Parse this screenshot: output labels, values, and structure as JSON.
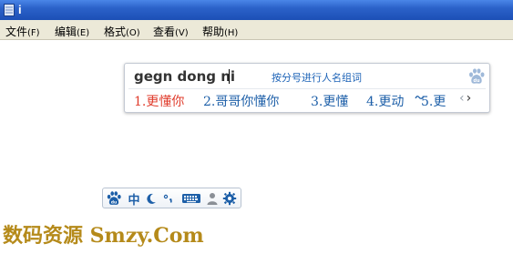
{
  "window": {
    "title": "i"
  },
  "menu": {
    "items": [
      {
        "label": "文件",
        "accel": "(F)"
      },
      {
        "label": "编辑",
        "accel": "(E)"
      },
      {
        "label": "格式",
        "accel": "(O)"
      },
      {
        "label": "查看",
        "accel": "(V)"
      },
      {
        "label": "帮助",
        "accel": "(H)"
      }
    ]
  },
  "ime": {
    "composition": "gegn dong ni",
    "hint": "按分号进行人名组词",
    "candidates": [
      {
        "label": "1.更懂你"
      },
      {
        "label": "2.哥哥你懂你"
      },
      {
        "label": "3.更懂"
      },
      {
        "label": "4.更动"
      },
      {
        "label": "5.更"
      }
    ],
    "nav": {
      "prev": "‹",
      "next": "›"
    }
  },
  "toolbar": {
    "lang": "中",
    "icons": [
      "baidu-paw-icon",
      "moon-icon",
      "punctuation-icon",
      "keyboard-icon",
      "user-icon",
      "gear-icon"
    ],
    "accent": "#1d5fa8"
  },
  "watermark": {
    "text": "数码资源 Smzy.Com"
  }
}
